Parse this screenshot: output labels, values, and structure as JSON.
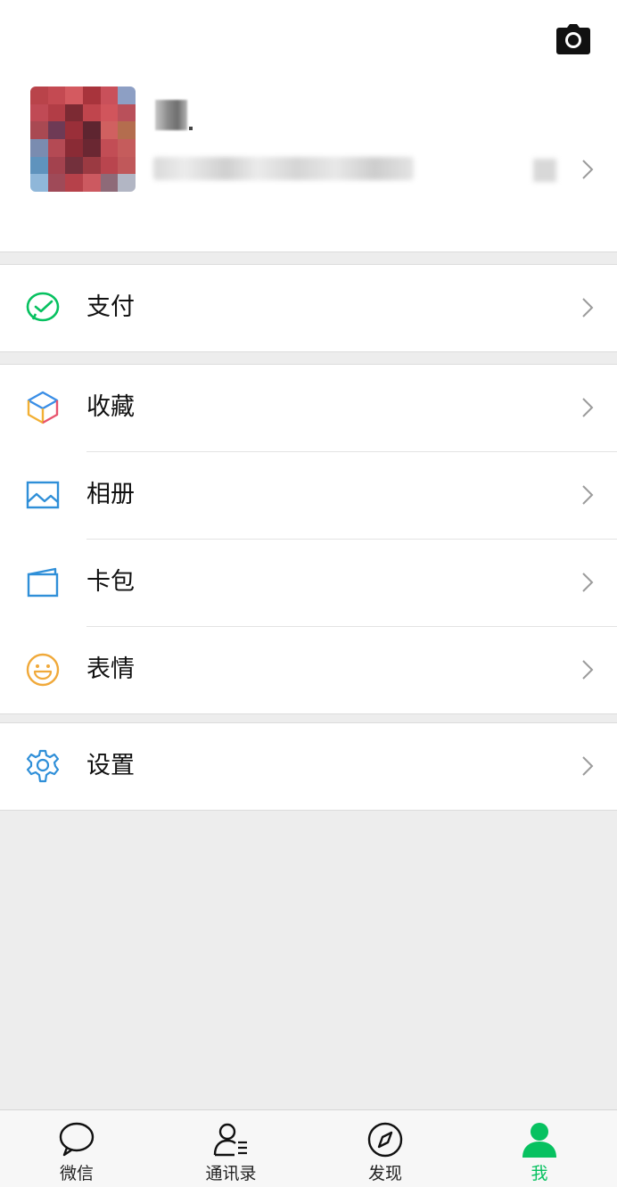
{
  "profile": {
    "camera_icon": "camera-icon",
    "avatar": "avatar",
    "chevron_icon": "chevron-right-icon"
  },
  "menu": {
    "pay": {
      "label": "支付",
      "icon": "pay-icon"
    },
    "favorites": {
      "label": "收藏",
      "icon": "favorites-icon"
    },
    "album": {
      "label": "相册",
      "icon": "album-icon"
    },
    "cards": {
      "label": "卡包",
      "icon": "card-wallet-icon"
    },
    "stickers": {
      "label": "表情",
      "icon": "emoji-icon"
    },
    "settings": {
      "label": "设置",
      "icon": "gear-icon"
    }
  },
  "tabbar": {
    "chats": {
      "label": "微信",
      "icon": "chat-bubble-icon"
    },
    "contacts": {
      "label": "通讯录",
      "icon": "contacts-icon"
    },
    "discover": {
      "label": "发现",
      "icon": "compass-icon"
    },
    "me": {
      "label": "我",
      "icon": "person-icon",
      "active": true
    }
  },
  "colors": {
    "accent_green": "#07c160",
    "background": "#ededed",
    "row_background": "#ffffff",
    "text_primary": "#111111",
    "tab_text": "#222222"
  }
}
